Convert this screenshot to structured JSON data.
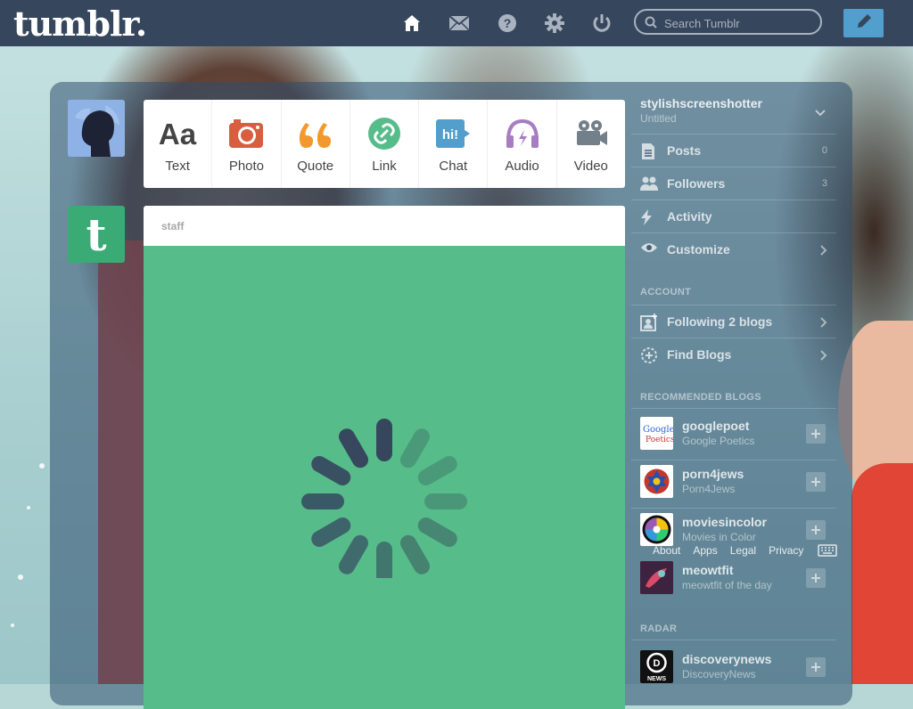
{
  "brand": {
    "logo_text": "tumblr."
  },
  "nav": {
    "icons": [
      "home-icon",
      "mail-icon",
      "help-icon",
      "gear-icon",
      "power-icon"
    ],
    "search_placeholder": "Search Tumblr",
    "compose_icon": "pencil-icon"
  },
  "post_types": [
    {
      "label": "Text",
      "icon": "text-icon",
      "color": "#444444"
    },
    {
      "label": "Photo",
      "icon": "camera-icon",
      "color": "#d95e40"
    },
    {
      "label": "Quote",
      "icon": "quote-icon",
      "color": "#f2992e"
    },
    {
      "label": "Link",
      "icon": "link-icon",
      "color": "#56bc8a"
    },
    {
      "label": "Chat",
      "icon": "chat-icon",
      "color": "#529ecc"
    },
    {
      "label": "Audio",
      "icon": "headphones-icon",
      "color": "#a77dc2"
    },
    {
      "label": "Video",
      "icon": "video-icon",
      "color": "#748089"
    }
  ],
  "post": {
    "author": "staff",
    "body_color": "#56bc8a"
  },
  "sidebar": {
    "blog_name": "stylishscreenshotter",
    "blog_title": "Untitled",
    "blog_items": [
      {
        "label": "Posts",
        "count": "0",
        "icon": "posts-icon"
      },
      {
        "label": "Followers",
        "count": "3",
        "icon": "followers-icon"
      },
      {
        "label": "Activity",
        "count": "",
        "icon": "activity-icon"
      },
      {
        "label": "Customize",
        "count": "",
        "icon": "eye-icon"
      }
    ],
    "account_header": "ACCOUNT",
    "account_items": [
      {
        "label": "Following 2 blogs",
        "icon": "following-icon"
      },
      {
        "label": "Find Blogs",
        "icon": "find-blogs-icon"
      }
    ],
    "recommended_header": "RECOMMENDED BLOGS",
    "recommended": [
      {
        "name": "googlepoet",
        "title": "Google Poetics"
      },
      {
        "name": "porn4jews",
        "title": "Porn4Jews"
      },
      {
        "name": "moviesincolor",
        "title": "Movies in Color"
      },
      {
        "name": "meowtfit",
        "title": "meowtfit of the day"
      }
    ],
    "footer_links": [
      "About",
      "Apps",
      "Legal",
      "Privacy"
    ],
    "radar_header": "RADAR",
    "radar": {
      "name": "discoverynews",
      "title": "DiscoveryNews"
    }
  },
  "colors": {
    "topbar": "#36465d",
    "accent": "#529ecc",
    "staff_green": "#3aab75"
  }
}
